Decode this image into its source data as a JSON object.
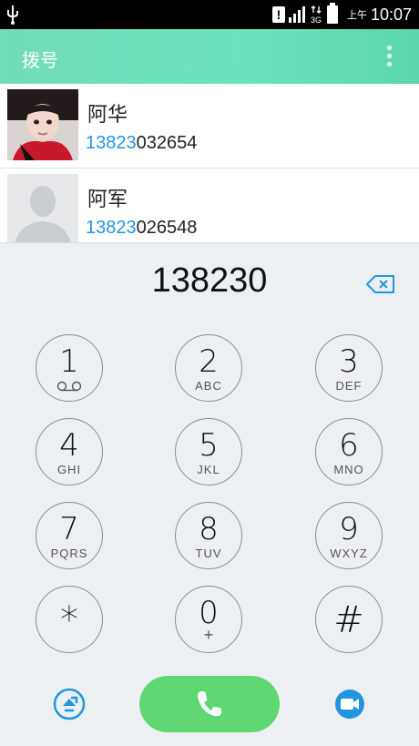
{
  "status_bar": {
    "ampm": "上午",
    "time": "10:07",
    "network": "3G"
  },
  "app_bar": {
    "title": "拨号"
  },
  "contacts": [
    {
      "name": "阿华",
      "number_match": "13823",
      "number_rest": "032654"
    },
    {
      "name": "阿军",
      "number_match": "13823",
      "number_rest": "026548"
    }
  ],
  "dialpad": {
    "entered": "138230",
    "keys": [
      {
        "num": "1",
        "letters": ""
      },
      {
        "num": "2",
        "letters": "ABC"
      },
      {
        "num": "3",
        "letters": "DEF"
      },
      {
        "num": "4",
        "letters": "GHI"
      },
      {
        "num": "5",
        "letters": "JKL"
      },
      {
        "num": "6",
        "letters": "MNO"
      },
      {
        "num": "7",
        "letters": "PQRS"
      },
      {
        "num": "8",
        "letters": "TUV"
      },
      {
        "num": "9",
        "letters": "WXYZ"
      },
      {
        "num": "*",
        "letters": ""
      },
      {
        "num": "0",
        "letters": "+"
      },
      {
        "num": "#",
        "letters": ""
      }
    ]
  },
  "colors": {
    "accent": "#2196e0",
    "appbar": "#6ee0bb",
    "call": "#5fd772"
  },
  "icons": [
    "usb-icon",
    "alert-icon",
    "signal-icon",
    "network-3g-icon",
    "battery-icon",
    "overflow-menu-icon",
    "backspace-icon",
    "voicemail-icon",
    "sim-switch-icon",
    "phone-icon",
    "video-call-icon"
  ]
}
